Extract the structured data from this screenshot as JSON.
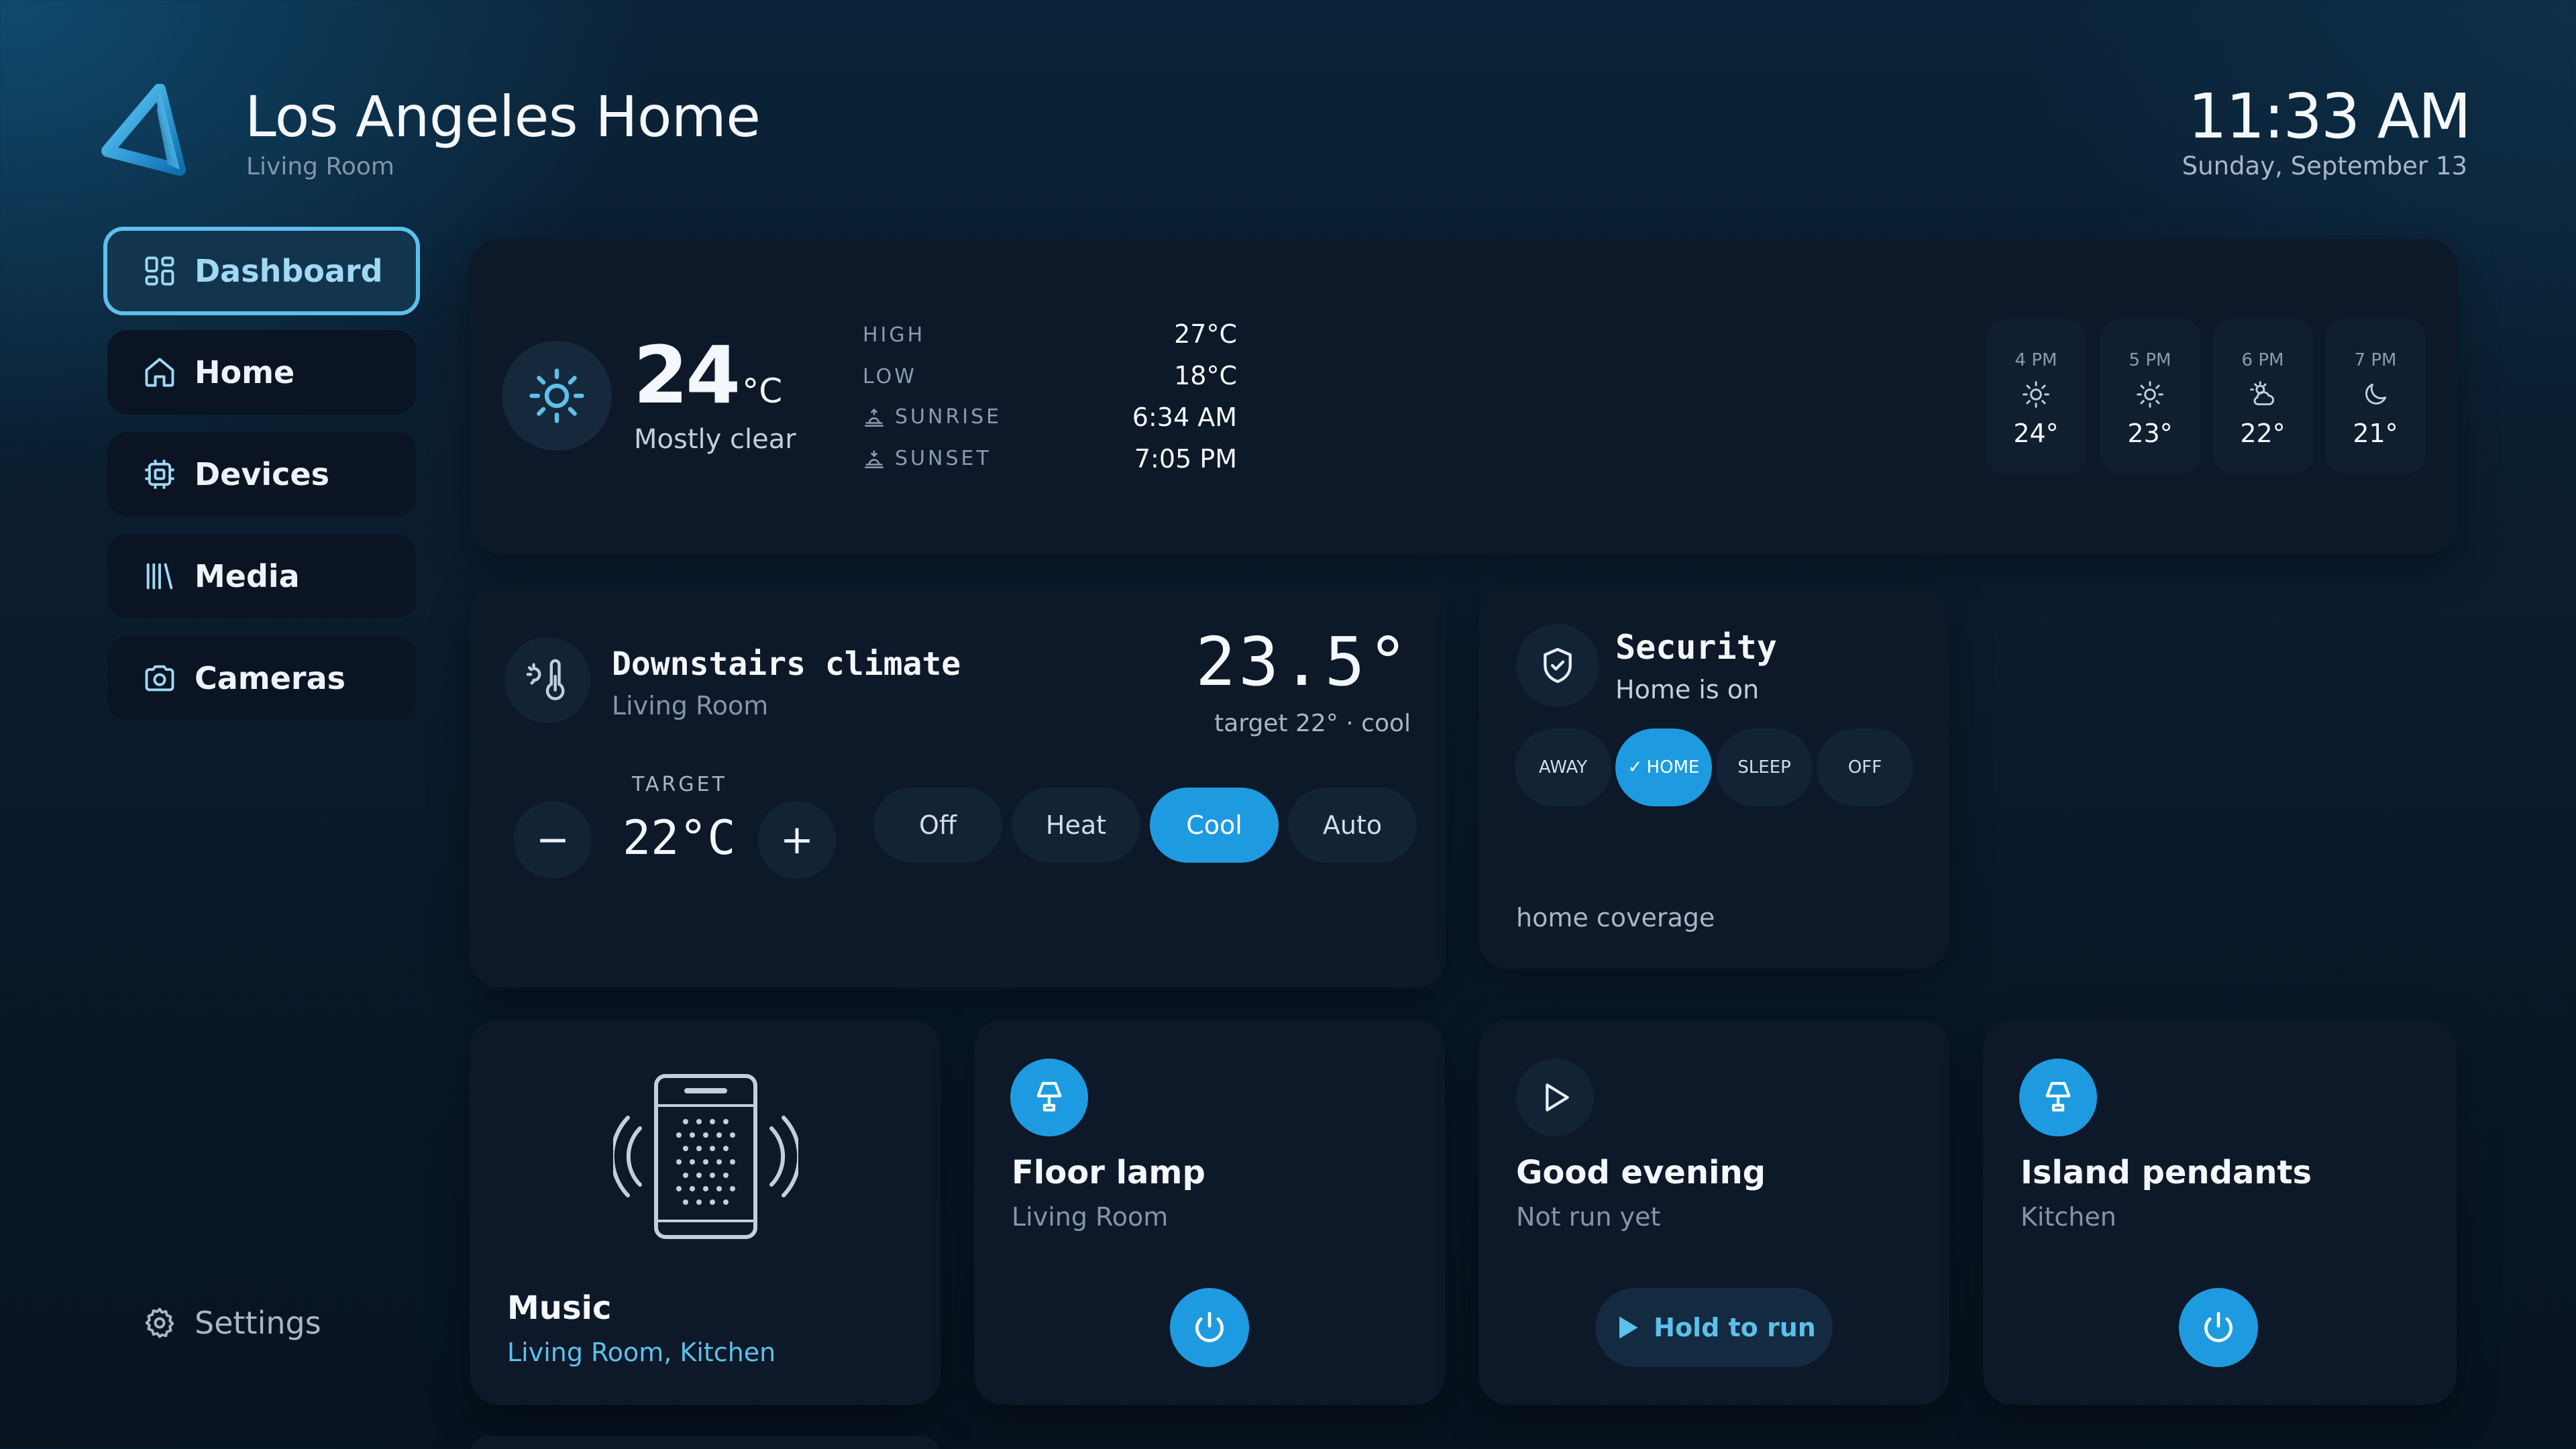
{
  "header": {
    "title": "Los Angeles Home",
    "subtitle": "Living Room",
    "time": "11:33 AM",
    "date": "Sunday, September 13"
  },
  "sidebar": {
    "items": [
      {
        "label": "Dashboard",
        "icon": "grid-icon",
        "active": true
      },
      {
        "label": "Home",
        "icon": "house-icon",
        "active": false
      },
      {
        "label": "Devices",
        "icon": "chip-icon",
        "active": false
      },
      {
        "label": "Media",
        "icon": "library-icon",
        "active": false
      },
      {
        "label": "Cameras",
        "icon": "camera-icon",
        "active": false
      }
    ],
    "settings_label": "Settings"
  },
  "weather": {
    "temp": "24",
    "unit": "°C",
    "condition": "Mostly clear",
    "stats": [
      {
        "label": "HIGH",
        "value": "27°C"
      },
      {
        "label": "LOW",
        "value": "18°C"
      },
      {
        "label": "SUNRISE",
        "value": "6:34 AM",
        "icon": "sunrise-icon"
      },
      {
        "label": "SUNSET",
        "value": "7:05 PM",
        "icon": "sunset-icon"
      }
    ],
    "hourly": [
      {
        "time": "4 PM",
        "icon": "sun-icon",
        "temp": "24°"
      },
      {
        "time": "5 PM",
        "icon": "sun-icon",
        "temp": "23°"
      },
      {
        "time": "6 PM",
        "icon": "partly-cloudy-icon",
        "temp": "22°"
      },
      {
        "time": "7 PM",
        "icon": "moon-icon",
        "temp": "21°"
      }
    ]
  },
  "climate": {
    "title": "Downstairs climate",
    "room": "Living Room",
    "current_temp": "23.5°",
    "target_note": "target 22° · cool",
    "target_label": "TARGET",
    "target_value": "22°C",
    "minus": "−",
    "plus": "+",
    "modes": [
      "Off",
      "Heat",
      "Cool",
      "Auto"
    ],
    "active_mode": "Cool"
  },
  "security": {
    "title": "Security",
    "status": "Home is on",
    "modes": [
      "AWAY",
      "HOME",
      "SLEEP",
      "OFF"
    ],
    "active_mode": "HOME",
    "coverage": "home coverage"
  },
  "cards": {
    "music": {
      "title": "Music",
      "rooms": "Living Room, Kitchen"
    },
    "floor_lamp": {
      "title": "Floor lamp",
      "room": "Living Room"
    },
    "good_evening": {
      "title": "Good evening",
      "status": "Not run yet",
      "action": "Hold to run"
    },
    "island_pendants": {
      "title": "Island pendants",
      "room": "Kitchen"
    }
  },
  "colors": {
    "accent": "#1e9be0",
    "accent_light": "#5cc0ec",
    "card_bg": "#0d1828"
  }
}
